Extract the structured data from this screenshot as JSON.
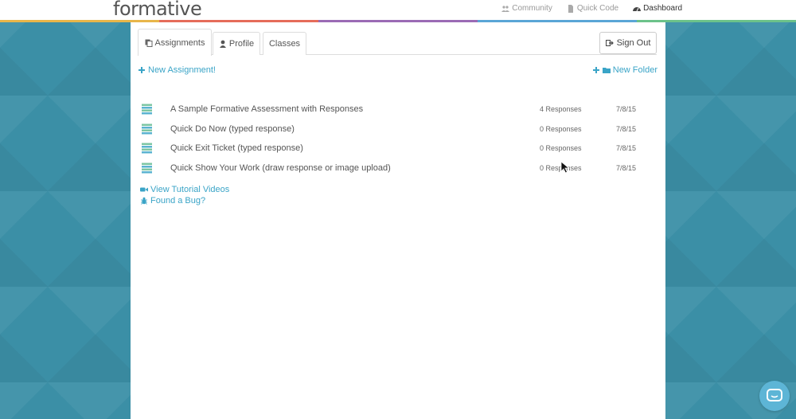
{
  "header": {
    "logo": "formative",
    "nav": [
      {
        "label": "Community",
        "icon": "users-icon"
      },
      {
        "label": "Quick Code",
        "icon": "file-icon"
      },
      {
        "label": "Dashboard",
        "icon": "dashboard-icon"
      }
    ],
    "rainbow_colors": [
      "#e8b64a",
      "#e56c5a",
      "#9b6bb5",
      "#5aa6d6",
      "#6cc28a"
    ]
  },
  "tabs": [
    {
      "label": "Assignments",
      "icon": "copy-icon",
      "active": true
    },
    {
      "label": "Profile",
      "icon": "user-icon",
      "active": false
    },
    {
      "label": "Classes",
      "active": false
    }
  ],
  "signout_label": "Sign Out",
  "actions": {
    "new_assignment": "New Assignment!",
    "new_folder": "New Folder"
  },
  "assignments": [
    {
      "title": "A Sample Formative Assessment with Responses",
      "responses": "4 Responses",
      "date": "7/8/15"
    },
    {
      "title": "Quick Do Now (typed response)",
      "responses": "0 Responses",
      "date": "7/8/15"
    },
    {
      "title": "Quick Exit Ticket (typed response)",
      "responses": "0 Responses",
      "date": "7/8/15"
    },
    {
      "title": "Quick Show Your Work (draw response or image upload)",
      "responses": "0 Responses",
      "date": "7/8/15"
    }
  ],
  "help_links": {
    "tutorial": "View Tutorial Videos",
    "bug": "Found a Bug?"
  },
  "colors": {
    "accent": "#3aa4c7",
    "background": "#3b8fa6",
    "doc_icon": "#7cc6a3"
  }
}
